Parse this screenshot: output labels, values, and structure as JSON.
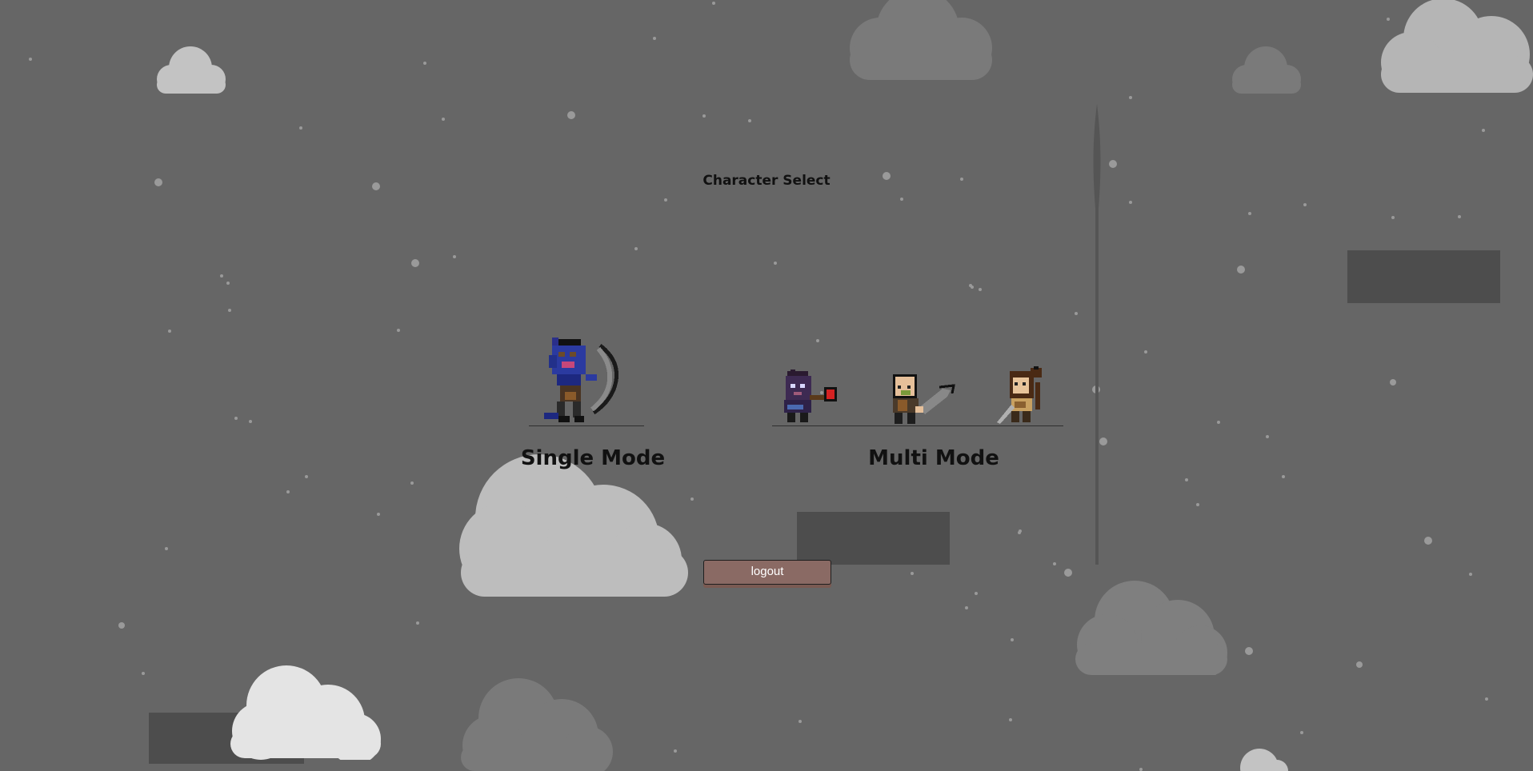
{
  "screen": {
    "title": "Character Select",
    "background_color": "#666666"
  },
  "modes": {
    "single": {
      "label": "Single Mode",
      "characters": [
        {
          "name": "blue-archer",
          "icon": "blue-horned-archer-sprite"
        }
      ]
    },
    "multi": {
      "label": "Multi Mode",
      "characters": [
        {
          "name": "dark-mage",
          "icon": "dark-mage-sprite"
        },
        {
          "name": "bald-warrior",
          "icon": "bald-warrior-sprite"
        },
        {
          "name": "brown-haired-fighter",
          "icon": "swordswoman-sprite"
        }
      ]
    }
  },
  "buttons": {
    "logout_label": "logout",
    "logout_color": "#8a6a64"
  }
}
